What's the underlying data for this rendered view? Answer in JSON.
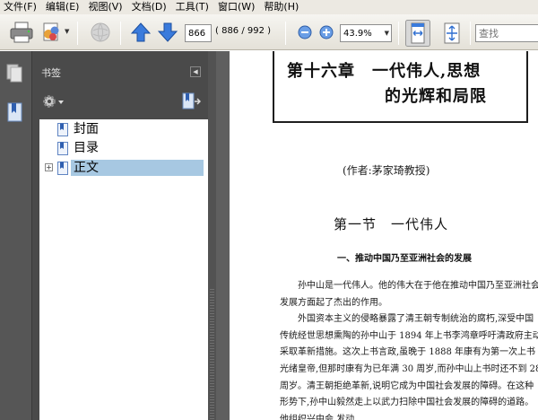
{
  "menu": [
    "文件(F)",
    "编辑(E)",
    "视图(V)",
    "文档(D)",
    "工具(T)",
    "窗口(W)",
    "帮助(H)"
  ],
  "toolbar": {
    "page_current": "866",
    "page_count": "( 886 / 992 )",
    "zoom_value": "43.9%",
    "search_placeholder": "查找"
  },
  "bookmarks": {
    "title": "书签",
    "items": [
      {
        "label": "封面"
      },
      {
        "label": "目录"
      },
      {
        "label": "正文"
      }
    ]
  },
  "document": {
    "chapter_line1": "第十六章　一代伟人,思想",
    "chapter_line2": "的光辉和局限",
    "author": "(作者:茅家琦教授)",
    "section_title": "第一节　一代伟人",
    "subsection_title": "一、推动中国乃至亚洲社会的发展",
    "paragraph1": "孙中山是一代伟人。他的伟大在于他在推动中国乃至亚洲社会发展方面起了杰出的作用。",
    "paragraph2": "外国资本主义的侵略暴露了清王朝专制统治的腐朽,深受中国传统经世思想熏陶的孙中山于 1894 年上书李鸿章呼吁清政府主动采取革新措施。这次上书言政,虽晚于 1888 年康有为第一次上书光绪皇帝,但那时康有为已年满 30 周岁,而孙中山上书时还不到 28 周岁。清王朝拒绝革新,说明它成为中国社会发展的障碍。在这种形势下,孙中山毅然走上以武力扫除中国社会发展的障碍的道路。他组织兴中会,发动"
  },
  "colors": {
    "nav_dark": "#4a4a4a",
    "selection": "#a7c8e2",
    "arrow_blue": "#2f6fd0"
  }
}
